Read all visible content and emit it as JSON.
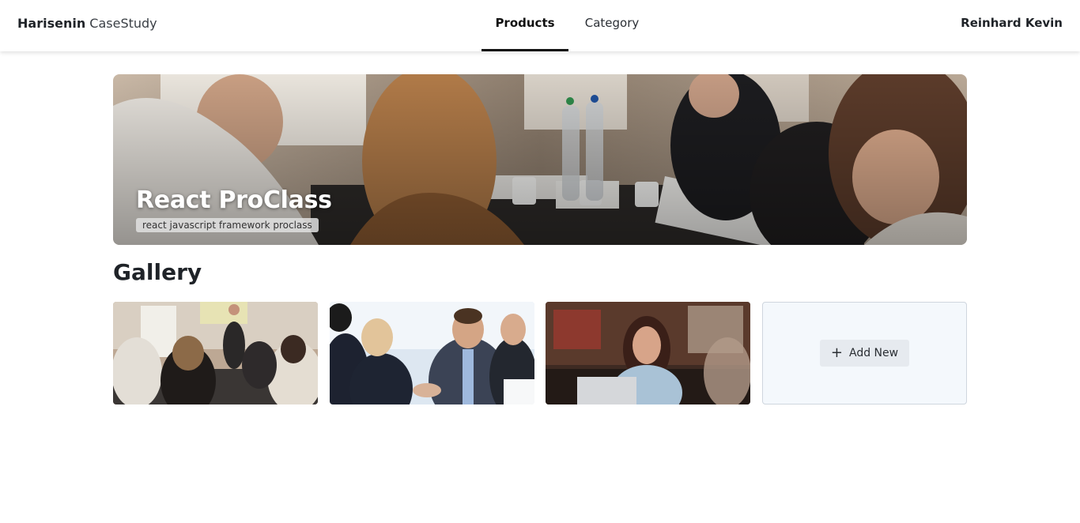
{
  "header": {
    "brand_main": "Harisenin",
    "brand_sub": "CaseStudy",
    "tabs": [
      {
        "label": "Products",
        "active": true
      },
      {
        "label": "Category",
        "active": false
      }
    ],
    "user_name": "Reinhard Kevin"
  },
  "hero": {
    "title": "React ProClass",
    "subtitle": "react javascript framework proclass"
  },
  "gallery": {
    "title": "Gallery",
    "add_new_label": "Add New",
    "add_icon": "plus-icon"
  },
  "colors": {
    "accent_underline": "#111111",
    "add_card_bg": "#f4f8fc"
  }
}
